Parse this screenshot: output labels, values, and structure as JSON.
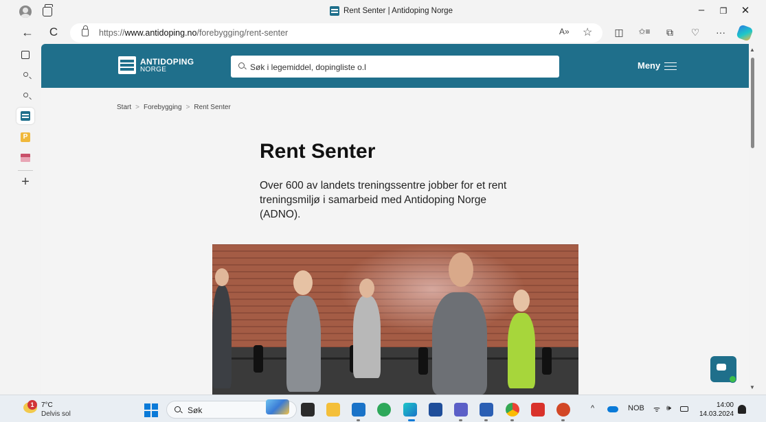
{
  "window": {
    "title": "Rent Senter | Antidoping Norge",
    "minimize": "–",
    "restore": "❐",
    "close": "✕"
  },
  "browser": {
    "url_prefix": "https://",
    "url_domain": "www.antidoping.no",
    "url_path": "/forebygging/rent-senter",
    "back": "←",
    "refresh": "C",
    "read_aloud": "A»",
    "favorite": "☆",
    "split": "◫",
    "favorites_bar": "✩≡",
    "collections": "⧉",
    "extensions": "♡",
    "more": "···"
  },
  "site": {
    "logo_title": "ANTIDOPING",
    "logo_subtitle": "NORGE",
    "search_placeholder": "Søk i legemiddel, dopingliste o.l",
    "menu_label": "Meny",
    "breadcrumb": [
      "Start",
      "Forebygging",
      "Rent Senter"
    ],
    "breadcrumb_separator": ">",
    "title": "Rent Senter",
    "lead": "Over 600 av landets treningssentre jobber for et rent treningsmiljø i samarbeid med Antidoping Norge (ADNO)."
  },
  "sidebar": {
    "add": "+"
  },
  "taskbar": {
    "weather_temp": "7°C",
    "weather_desc": "Delvis sol",
    "weather_badge": "1",
    "search_label": "Søk",
    "tray_chevron": "^",
    "language": "NOB",
    "wifi": "ᯤ",
    "volume": "🕪",
    "time": "14:00",
    "date": "14.03.2024"
  },
  "colors": {
    "brand": "#1f6f8b",
    "page_bg": "#f4f4f4"
  }
}
